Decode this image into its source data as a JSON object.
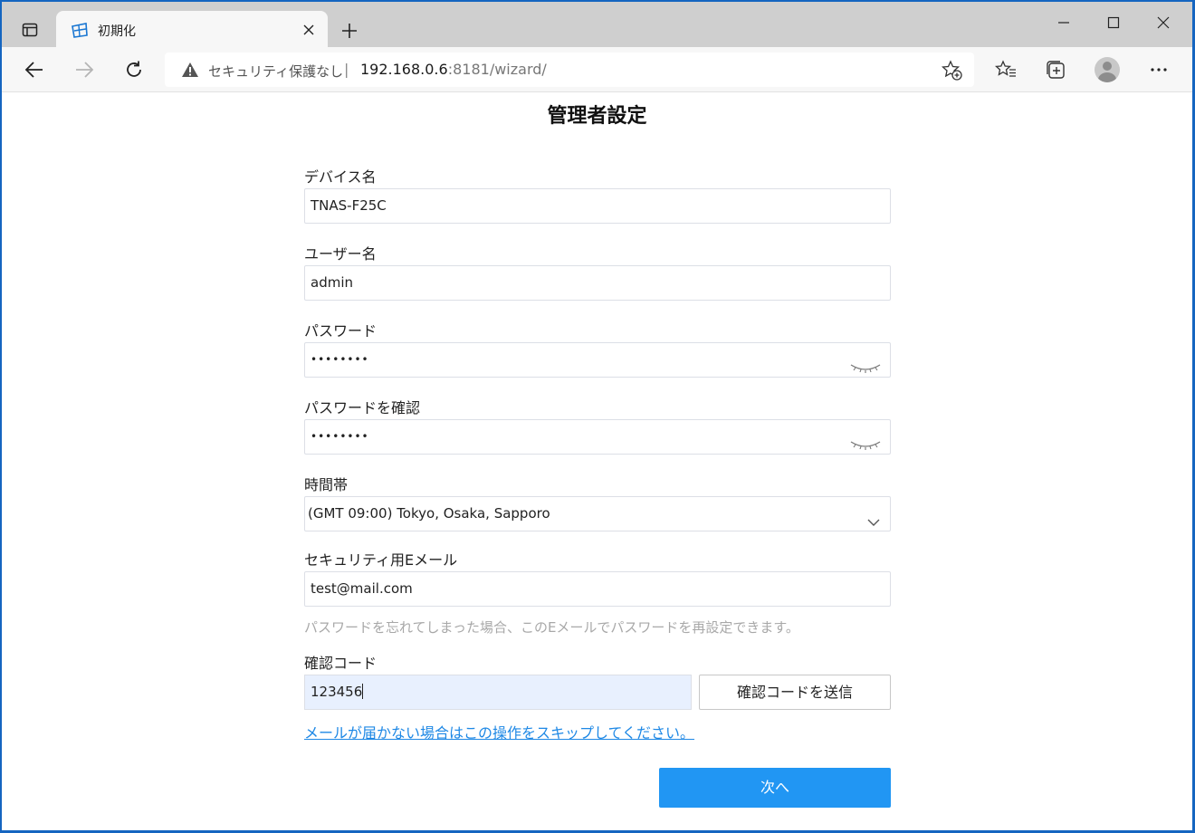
{
  "browser": {
    "tab_title": "初期化",
    "security_text": "セキュリティ保護なし",
    "separator": "|",
    "url_host": "192.168.0.6",
    "url_rest": ":8181/wizard/"
  },
  "page": {
    "title": "管理者設定",
    "device_name": {
      "label": "デバイス名",
      "value": "TNAS-F25C"
    },
    "username": {
      "label": "ユーザー名",
      "value": "admin"
    },
    "password": {
      "label": "パスワード",
      "value": "••••••••"
    },
    "password_confirm": {
      "label": "パスワードを確認",
      "value": "••••••••"
    },
    "timezone": {
      "label": "時間帯",
      "value": "(GMT 09:00) Tokyo, Osaka, Sapporo"
    },
    "security_email": {
      "label": "セキュリティ用Eメール",
      "value": "test@mail.com",
      "hint": "パスワードを忘れてしまった場合、このEメールでパスワードを再設定できます。"
    },
    "verification_code": {
      "label": "確認コード",
      "value": "123456",
      "send_button": "確認コードを送信"
    },
    "skip_link": "メールが届かない場合はこの操作をスキップしてください。",
    "next_button": "次へ"
  },
  "colors": {
    "accent": "#2196f3",
    "link": "#1e88e5",
    "autofill_bg": "#e8f0fe"
  },
  "icons": [
    "tab-actions-icon",
    "tab-favicon",
    "close-icon",
    "plus-icon",
    "minimize-icon",
    "maximize-icon",
    "window-close-icon",
    "back-arrow-icon",
    "forward-arrow-icon",
    "refresh-icon",
    "warning-icon",
    "add-favorite-icon",
    "favorites-icon",
    "collections-icon",
    "profile-avatar",
    "more-icon",
    "eye-closed-icon",
    "chevron-down-icon"
  ]
}
